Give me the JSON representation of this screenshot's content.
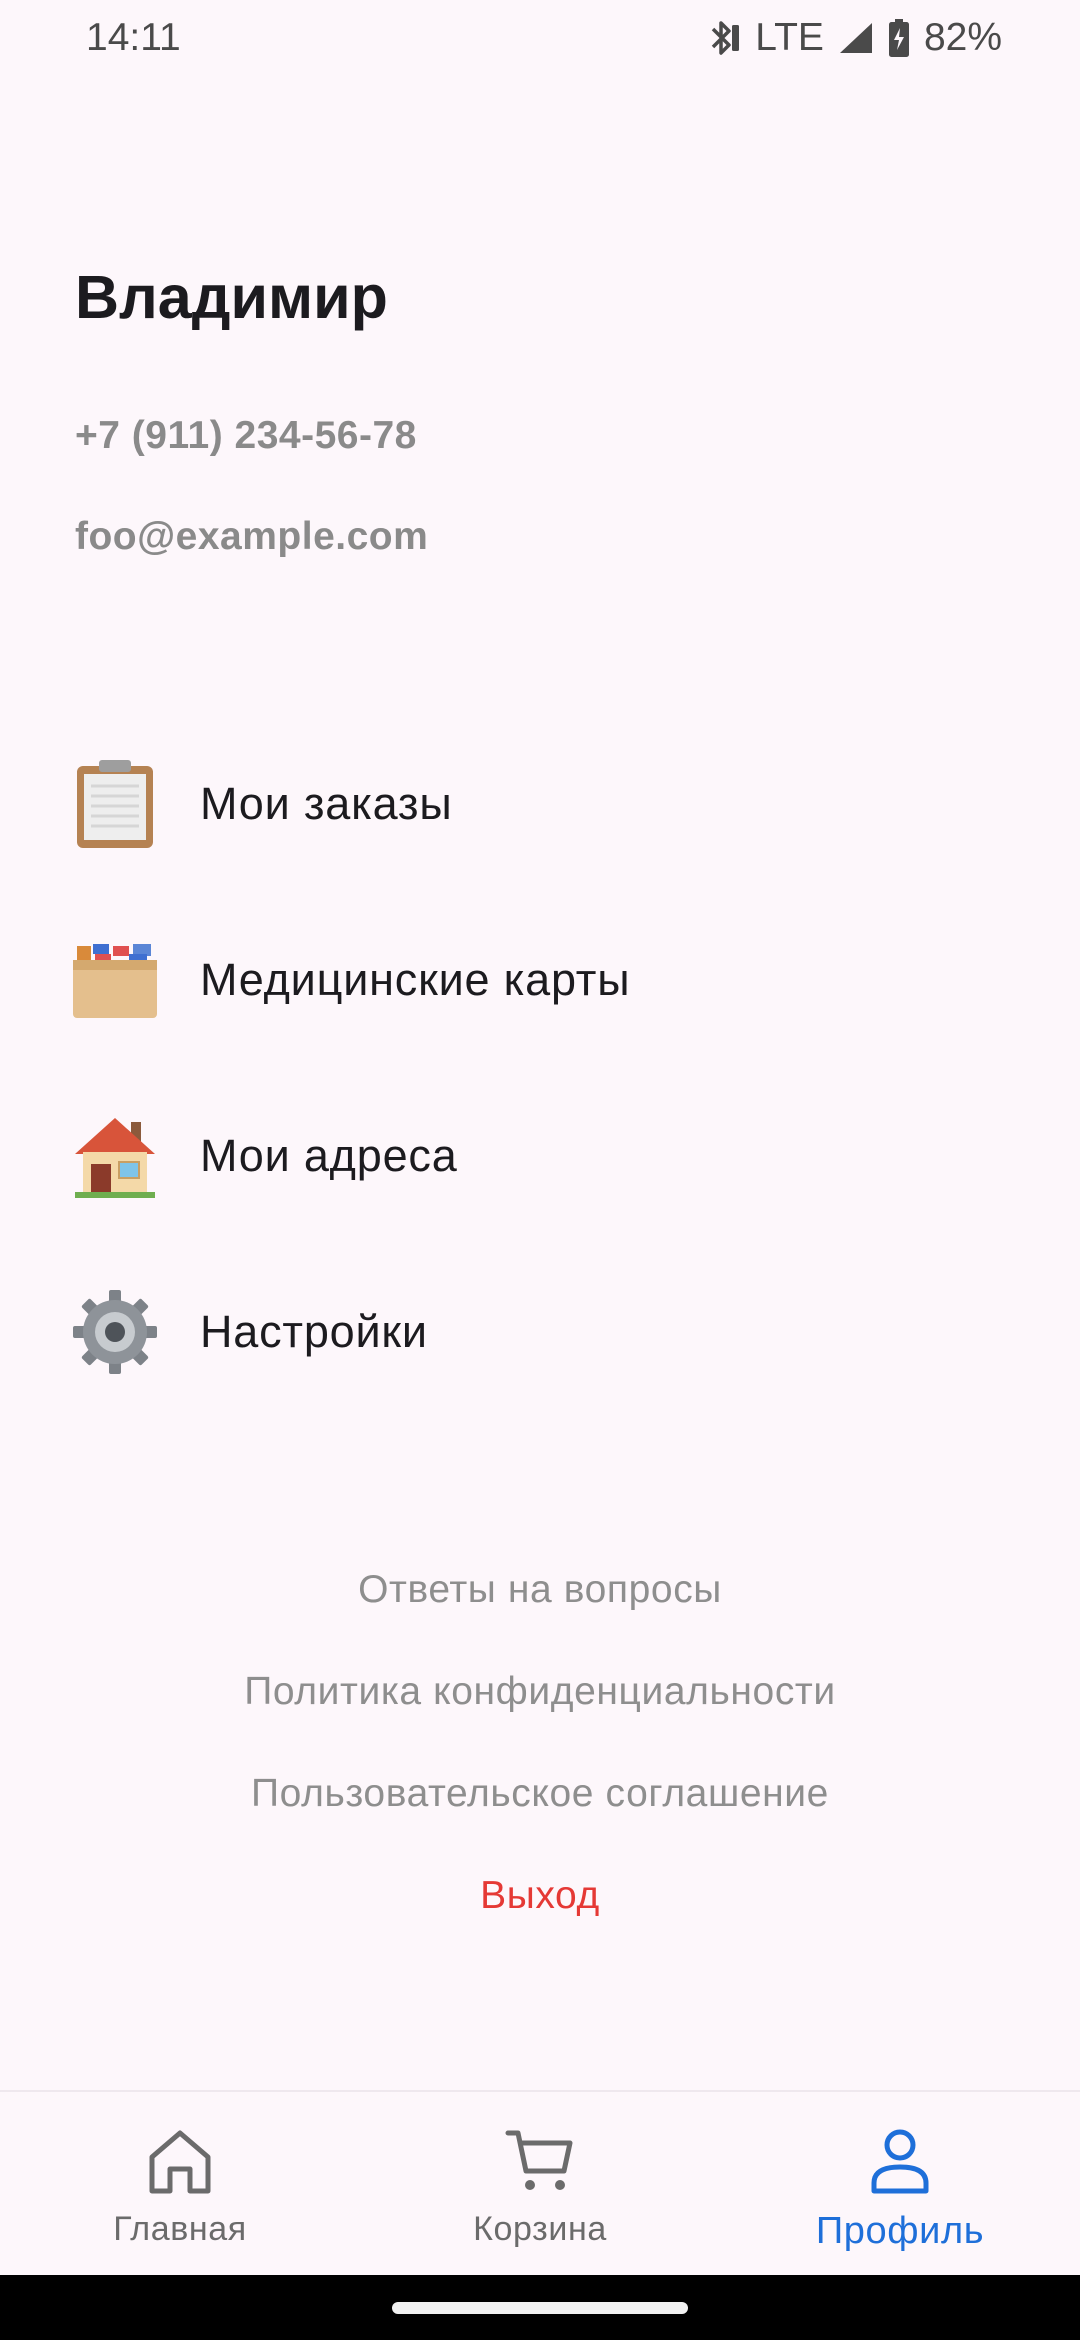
{
  "status_bar": {
    "time": "14:11",
    "network": "LTE",
    "battery": "82%",
    "icons": [
      "bluetooth-icon",
      "signal-icon",
      "battery-charging-icon"
    ]
  },
  "profile": {
    "name": "Владимир",
    "phone": "+7 (911) 234-56-78",
    "email": "foo@example.com"
  },
  "menu": [
    {
      "label": "Мои заказы",
      "icon": "clipboard-icon"
    },
    {
      "label": "Медицинские карты",
      "icon": "card-file-box-icon"
    },
    {
      "label": "Мои адреса",
      "icon": "house-icon"
    },
    {
      "label": "Настройки",
      "icon": "gear-icon"
    }
  ],
  "links": {
    "faq": "Ответы на вопросы",
    "privacy": "Политика конфиденциальности",
    "agreement": "Пользовательское соглашение",
    "logout": "Выход"
  },
  "bottom_nav": {
    "items": [
      {
        "label": "Главная",
        "icon": "home-icon",
        "active": false
      },
      {
        "label": "Корзина",
        "icon": "cart-icon",
        "active": false
      },
      {
        "label": "Профиль",
        "icon": "person-icon",
        "active": true
      }
    ],
    "active_color": "#1e6fd9",
    "inactive_color": "#6b6b6b"
  },
  "colors": {
    "background": "#fdf7fb",
    "logout": "#e53935",
    "muted_text": "#8e8e8e"
  }
}
